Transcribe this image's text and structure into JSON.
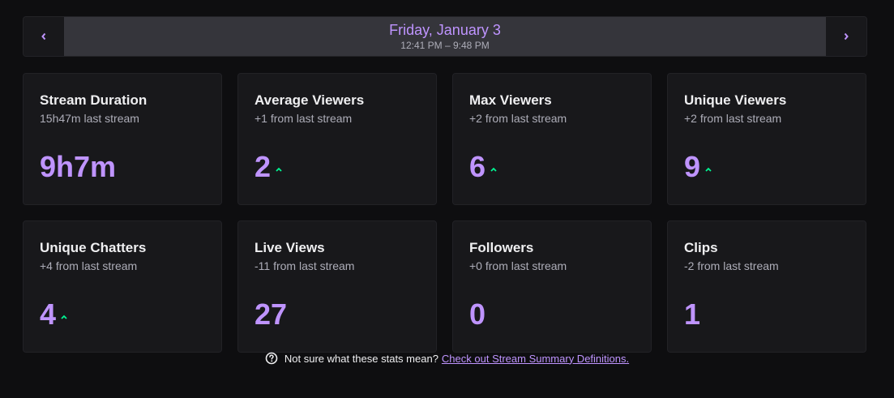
{
  "date_nav": {
    "title": "Friday, January 3",
    "time_range": "12:41 PM – 9:48 PM",
    "prev_icon": "chevron-left-icon",
    "next_icon": "chevron-right-icon"
  },
  "stats": [
    {
      "title": "Stream Duration",
      "sub": "15h47m last stream",
      "value": "9h7m",
      "trend": "none"
    },
    {
      "title": "Average Viewers",
      "sub": "+1 from last stream",
      "value": "2",
      "trend": "up"
    },
    {
      "title": "Max Viewers",
      "sub": "+2 from last stream",
      "value": "6",
      "trend": "up"
    },
    {
      "title": "Unique Viewers",
      "sub": "+2 from last stream",
      "value": "9",
      "trend": "up"
    },
    {
      "title": "Unique Chatters",
      "sub": "+4 from last stream",
      "value": "4",
      "trend": "up"
    },
    {
      "title": "Live Views",
      "sub": "-11 from last stream",
      "value": "27",
      "trend": "none"
    },
    {
      "title": "Followers",
      "sub": "+0 from last stream",
      "value": "0",
      "trend": "none"
    },
    {
      "title": "Clips",
      "sub": "-2 from last stream",
      "value": "1",
      "trend": "none"
    }
  ],
  "footer": {
    "text": "Not sure what these stats mean?",
    "link": "Check out Stream Summary Definitions.",
    "icon": "help-circle-icon"
  },
  "colors": {
    "accent": "#bf94ff",
    "up_trend": "#00f593",
    "background": "#0e0e10",
    "card": "#18181b"
  }
}
